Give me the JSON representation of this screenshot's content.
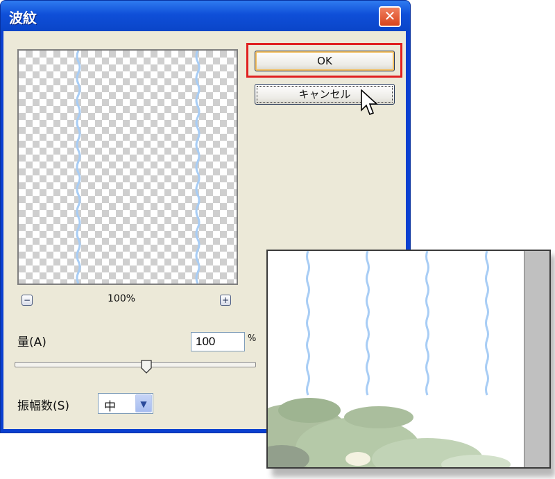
{
  "window": {
    "title": "波紋",
    "close_glyph": "✕"
  },
  "buttons": {
    "ok": "OK",
    "cancel": "キャンセル"
  },
  "preview": {
    "zoom_level": "100%",
    "zoom_out": "−",
    "zoom_in": "+"
  },
  "amount": {
    "label": "量(A)",
    "value": "100",
    "unit": "%",
    "slider_fraction": 0.55
  },
  "size": {
    "label": "振幅数(S)",
    "selected": "中"
  },
  "colors": {
    "ripple": "#a8cdf5",
    "highlight": "#e02020",
    "titlebar": "#0f4fd8"
  },
  "icons": [
    "close-icon",
    "zoom-out-icon",
    "zoom-in-icon",
    "dropdown-arrow-icon",
    "mouse-cursor-icon"
  ]
}
